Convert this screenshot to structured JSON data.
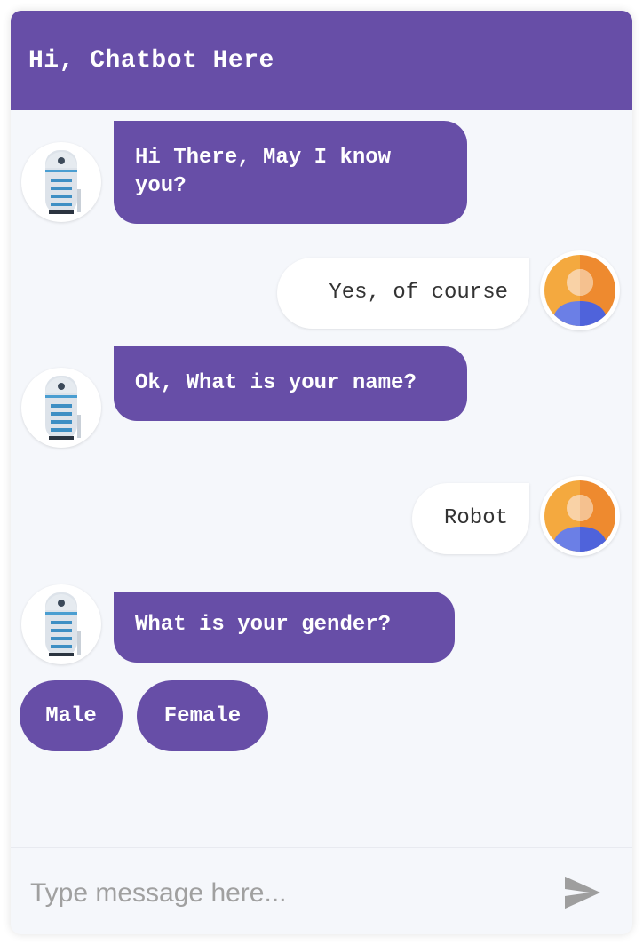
{
  "header": {
    "title": "Hi, Chatbot Here"
  },
  "messages": [
    {
      "sender": "bot",
      "text": "Hi There, May I know you?"
    },
    {
      "sender": "user",
      "text": "Yes, of course"
    },
    {
      "sender": "bot",
      "text": "Ok, What is your name?"
    },
    {
      "sender": "user",
      "text": "Robot"
    },
    {
      "sender": "bot",
      "text": "What is your gender?"
    }
  ],
  "options": [
    "Male",
    "Female"
  ],
  "input": {
    "placeholder": "Type message here...",
    "value": ""
  },
  "icons": {
    "bot_avatar": "robot-icon",
    "user_avatar": "user-avatar-icon",
    "send": "send-icon"
  },
  "colors": {
    "accent": "#674ea7",
    "background": "#f5f7fb",
    "user_bubble": "#ffffff",
    "avatar_orange": "#f39c3c",
    "avatar_blue": "#5468e0"
  }
}
